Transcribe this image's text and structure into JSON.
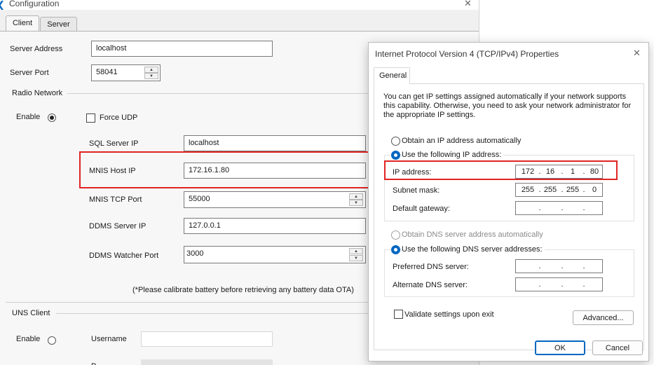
{
  "config_window": {
    "title": "Configuration",
    "close_glyph": "✕",
    "tabs": [
      {
        "label": "Client",
        "active": true
      },
      {
        "label": "Server",
        "active": false
      }
    ],
    "server_address": {
      "label": "Server Address",
      "value": "localhost"
    },
    "server_port": {
      "label": "Server Port",
      "value": "58041"
    },
    "radio_network": {
      "group_label": "Radio Network",
      "enable_label": "Enable",
      "enable_selected": true,
      "force_udp_label": "Force UDP",
      "force_udp_checked": false,
      "sql_server_ip": {
        "label": "SQL Server IP",
        "value": "localhost"
      },
      "mnis_host_ip": {
        "label": "MNIS Host IP",
        "value": "172.16.1.80"
      },
      "mnis_tcp_port": {
        "label": "MNIS TCP Port",
        "value": "55000"
      },
      "ddms_server_ip": {
        "label": "DDMS Server IP",
        "value": "127.0.0.1"
      },
      "ddms_watcher_port": {
        "label": "DDMS Watcher Port",
        "value": "3000"
      },
      "note": "(*Please calibrate battery before retrieving any battery data OTA)"
    },
    "uns_client": {
      "group_label": "UNS Client",
      "enable_label": "Enable",
      "enable_selected": false,
      "username_label": "Username",
      "username_value": ""
    }
  },
  "ipv4_dialog": {
    "title": "Internet Protocol Version 4 (TCP/IPv4) Properties",
    "close_glyph": "✕",
    "tab_label": "General",
    "description": "You can get IP settings assigned automatically if your network supports this capability. Otherwise, you need to ask your network administrator for the appropriate IP settings.",
    "obtain_ip_auto_label": "Obtain an IP address automatically",
    "use_following_ip_label": "Use the following IP address:",
    "ip_selection": "manual",
    "ip_address": {
      "label": "IP address:",
      "octets": [
        "172",
        "16",
        "1",
        "80"
      ]
    },
    "subnet_mask": {
      "label": "Subnet mask:",
      "octets": [
        "255",
        "255",
        "255",
        "0"
      ]
    },
    "default_gateway": {
      "label": "Default gateway:",
      "octets": [
        "",
        "",
        "",
        ""
      ]
    },
    "obtain_dns_auto_label": "Obtain DNS server address automatically",
    "use_following_dns_label": "Use the following DNS server addresses:",
    "dns_selection": "manual",
    "preferred_dns": {
      "label": "Preferred DNS server:",
      "octets": [
        "",
        "",
        "",
        ""
      ]
    },
    "alternate_dns": {
      "label": "Alternate DNS server:",
      "octets": [
        "",
        "",
        "",
        ""
      ]
    },
    "validate_label": "Validate settings upon exit",
    "validate_checked": false,
    "advanced_label": "Advanced...",
    "ok_label": "OK",
    "cancel_label": "Cancel"
  },
  "colors": {
    "highlight_box": "#e02424",
    "accent_radio": "#0067c0"
  }
}
